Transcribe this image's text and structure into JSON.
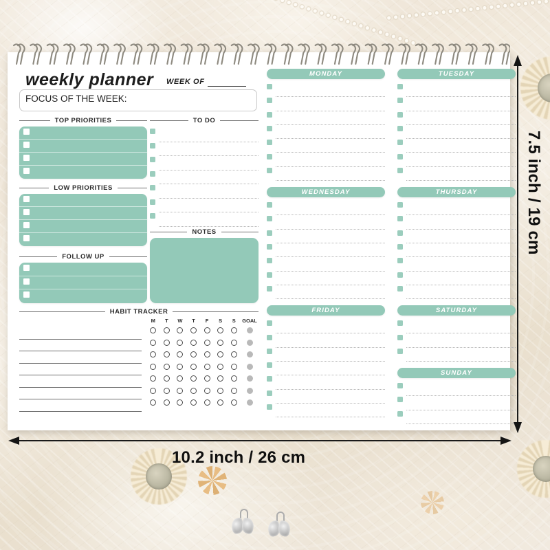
{
  "background": {
    "description": "cream lace fabric with pearls",
    "base_color": "#efe8dd"
  },
  "colors": {
    "mint": "#93c9b8",
    "mint_checkbox": "#9bcdbd",
    "paper": "#ffffff",
    "rule": "#6f6f6f",
    "goal_dot": "#b9b9b9"
  },
  "planner": {
    "title": "weekly planner",
    "week_of_label": "WEEK OF",
    "focus_label": "FOCUS OF THE WEEK:",
    "sections": {
      "top_priorities": {
        "heading": "TOP PRIORITIES",
        "rows": 4
      },
      "low_priorities": {
        "heading": "LOW PRIORITIES",
        "rows": 4
      },
      "follow_up": {
        "heading": "FOLLOW UP",
        "rows": 3
      },
      "to_do": {
        "heading": "TO DO",
        "rows": 7
      },
      "notes": {
        "heading": "NOTES"
      },
      "habit_tracker": {
        "heading": "HABIT TRACKER",
        "column_headers": [
          "M",
          "T",
          "W",
          "T",
          "F",
          "S",
          "S",
          "GOAL"
        ],
        "rows": 7
      }
    },
    "days": [
      {
        "name": "MONDAY",
        "rows": 7
      },
      {
        "name": "TUESDAY",
        "rows": 7
      },
      {
        "name": "WEDNESDAY",
        "rows": 7
      },
      {
        "name": "THURSDAY",
        "rows": 7
      },
      {
        "name": "FRIDAY",
        "rows": 7
      },
      {
        "name": "SATURDAY",
        "rows": 3
      },
      {
        "name": "SUNDAY",
        "rows": 3
      }
    ]
  },
  "dimensions": {
    "width_label": "10.2 inch / 26 cm",
    "height_label": "7.5 inch / 19 cm"
  }
}
